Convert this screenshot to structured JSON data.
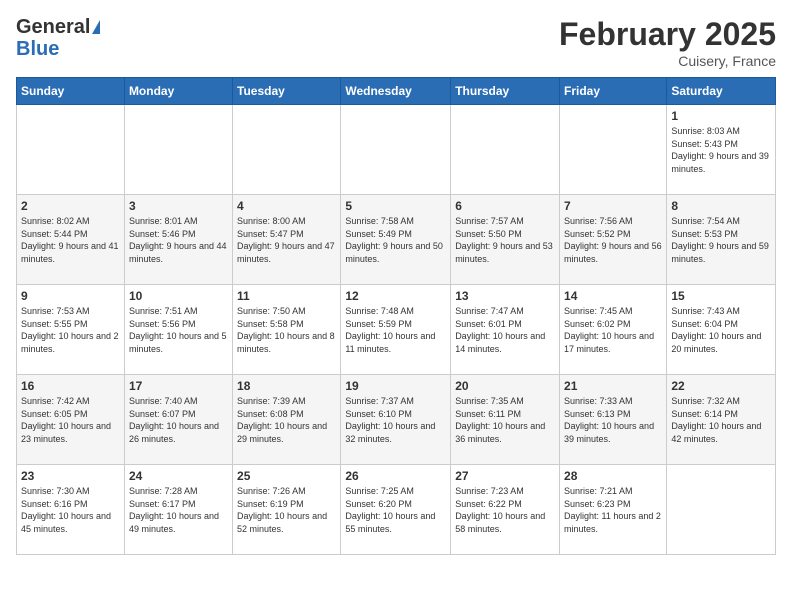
{
  "header": {
    "logo_general": "General",
    "logo_blue": "Blue",
    "month_title": "February 2025",
    "location": "Cuisery, France"
  },
  "days_of_week": [
    "Sunday",
    "Monday",
    "Tuesday",
    "Wednesday",
    "Thursday",
    "Friday",
    "Saturday"
  ],
  "weeks": [
    [
      {
        "day": "",
        "info": ""
      },
      {
        "day": "",
        "info": ""
      },
      {
        "day": "",
        "info": ""
      },
      {
        "day": "",
        "info": ""
      },
      {
        "day": "",
        "info": ""
      },
      {
        "day": "",
        "info": ""
      },
      {
        "day": "1",
        "info": "Sunrise: 8:03 AM\nSunset: 5:43 PM\nDaylight: 9 hours and 39 minutes."
      }
    ],
    [
      {
        "day": "2",
        "info": "Sunrise: 8:02 AM\nSunset: 5:44 PM\nDaylight: 9 hours and 41 minutes."
      },
      {
        "day": "3",
        "info": "Sunrise: 8:01 AM\nSunset: 5:46 PM\nDaylight: 9 hours and 44 minutes."
      },
      {
        "day": "4",
        "info": "Sunrise: 8:00 AM\nSunset: 5:47 PM\nDaylight: 9 hours and 47 minutes."
      },
      {
        "day": "5",
        "info": "Sunrise: 7:58 AM\nSunset: 5:49 PM\nDaylight: 9 hours and 50 minutes."
      },
      {
        "day": "6",
        "info": "Sunrise: 7:57 AM\nSunset: 5:50 PM\nDaylight: 9 hours and 53 minutes."
      },
      {
        "day": "7",
        "info": "Sunrise: 7:56 AM\nSunset: 5:52 PM\nDaylight: 9 hours and 56 minutes."
      },
      {
        "day": "8",
        "info": "Sunrise: 7:54 AM\nSunset: 5:53 PM\nDaylight: 9 hours and 59 minutes."
      }
    ],
    [
      {
        "day": "9",
        "info": "Sunrise: 7:53 AM\nSunset: 5:55 PM\nDaylight: 10 hours and 2 minutes."
      },
      {
        "day": "10",
        "info": "Sunrise: 7:51 AM\nSunset: 5:56 PM\nDaylight: 10 hours and 5 minutes."
      },
      {
        "day": "11",
        "info": "Sunrise: 7:50 AM\nSunset: 5:58 PM\nDaylight: 10 hours and 8 minutes."
      },
      {
        "day": "12",
        "info": "Sunrise: 7:48 AM\nSunset: 5:59 PM\nDaylight: 10 hours and 11 minutes."
      },
      {
        "day": "13",
        "info": "Sunrise: 7:47 AM\nSunset: 6:01 PM\nDaylight: 10 hours and 14 minutes."
      },
      {
        "day": "14",
        "info": "Sunrise: 7:45 AM\nSunset: 6:02 PM\nDaylight: 10 hours and 17 minutes."
      },
      {
        "day": "15",
        "info": "Sunrise: 7:43 AM\nSunset: 6:04 PM\nDaylight: 10 hours and 20 minutes."
      }
    ],
    [
      {
        "day": "16",
        "info": "Sunrise: 7:42 AM\nSunset: 6:05 PM\nDaylight: 10 hours and 23 minutes."
      },
      {
        "day": "17",
        "info": "Sunrise: 7:40 AM\nSunset: 6:07 PM\nDaylight: 10 hours and 26 minutes."
      },
      {
        "day": "18",
        "info": "Sunrise: 7:39 AM\nSunset: 6:08 PM\nDaylight: 10 hours and 29 minutes."
      },
      {
        "day": "19",
        "info": "Sunrise: 7:37 AM\nSunset: 6:10 PM\nDaylight: 10 hours and 32 minutes."
      },
      {
        "day": "20",
        "info": "Sunrise: 7:35 AM\nSunset: 6:11 PM\nDaylight: 10 hours and 36 minutes."
      },
      {
        "day": "21",
        "info": "Sunrise: 7:33 AM\nSunset: 6:13 PM\nDaylight: 10 hours and 39 minutes."
      },
      {
        "day": "22",
        "info": "Sunrise: 7:32 AM\nSunset: 6:14 PM\nDaylight: 10 hours and 42 minutes."
      }
    ],
    [
      {
        "day": "23",
        "info": "Sunrise: 7:30 AM\nSunset: 6:16 PM\nDaylight: 10 hours and 45 minutes."
      },
      {
        "day": "24",
        "info": "Sunrise: 7:28 AM\nSunset: 6:17 PM\nDaylight: 10 hours and 49 minutes."
      },
      {
        "day": "25",
        "info": "Sunrise: 7:26 AM\nSunset: 6:19 PM\nDaylight: 10 hours and 52 minutes."
      },
      {
        "day": "26",
        "info": "Sunrise: 7:25 AM\nSunset: 6:20 PM\nDaylight: 10 hours and 55 minutes."
      },
      {
        "day": "27",
        "info": "Sunrise: 7:23 AM\nSunset: 6:22 PM\nDaylight: 10 hours and 58 minutes."
      },
      {
        "day": "28",
        "info": "Sunrise: 7:21 AM\nSunset: 6:23 PM\nDaylight: 11 hours and 2 minutes."
      },
      {
        "day": "",
        "info": ""
      }
    ]
  ]
}
